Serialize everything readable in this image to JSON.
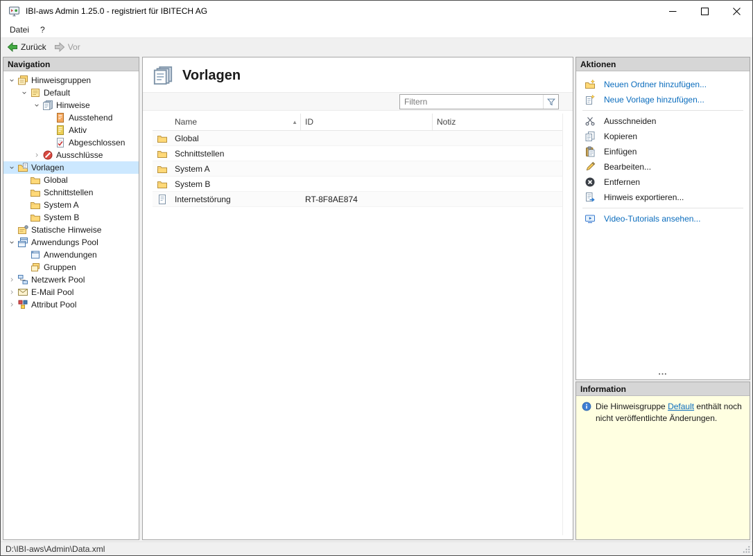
{
  "window": {
    "title": "IBI-aws Admin 1.25.0 - registriert für IBITECH AG"
  },
  "menu": {
    "items": [
      {
        "label": "Datei"
      },
      {
        "label": "?"
      }
    ]
  },
  "toolbar": {
    "back_label": "Zurück",
    "forward_label": "Vor",
    "forward_enabled": false
  },
  "navigation": {
    "header": "Navigation",
    "tree": [
      {
        "label": "Hinweisgruppen",
        "level": 0,
        "state": "expanded",
        "icon": "notice-groups-icon"
      },
      {
        "label": "Default",
        "level": 1,
        "state": "expanded",
        "icon": "notice-group-icon"
      },
      {
        "label": "Hinweise",
        "level": 2,
        "state": "expanded",
        "icon": "notices-icon"
      },
      {
        "label": "Ausstehend",
        "level": 3,
        "state": "leaf",
        "icon": "pending-notices-icon"
      },
      {
        "label": "Aktiv",
        "level": 3,
        "state": "leaf",
        "icon": "active-notices-icon"
      },
      {
        "label": "Abgeschlossen",
        "level": 3,
        "state": "leaf",
        "icon": "completed-notices-icon"
      },
      {
        "label": "Ausschlüsse",
        "level": 2,
        "state": "collapsed",
        "icon": "exclusions-icon"
      },
      {
        "label": "Vorlagen",
        "level": 0,
        "state": "expanded",
        "icon": "templates-folder-icon",
        "selected": true
      },
      {
        "label": "Global",
        "level": 1,
        "state": "leaf",
        "icon": "folder-icon"
      },
      {
        "label": "Schnittstellen",
        "level": 1,
        "state": "leaf",
        "icon": "folder-icon"
      },
      {
        "label": "System A",
        "level": 1,
        "state": "leaf",
        "icon": "folder-icon"
      },
      {
        "label": "System B",
        "level": 1,
        "state": "leaf",
        "icon": "folder-icon"
      },
      {
        "label": "Statische Hinweise",
        "level": 0,
        "state": "leaf",
        "icon": "static-notices-icon"
      },
      {
        "label": "Anwendungs Pool",
        "level": 0,
        "state": "expanded",
        "icon": "application-pool-icon"
      },
      {
        "label": "Anwendungen",
        "level": 1,
        "state": "leaf",
        "icon": "applications-icon"
      },
      {
        "label": "Gruppen",
        "level": 1,
        "state": "leaf",
        "icon": "groups-icon"
      },
      {
        "label": "Netzwerk Pool",
        "level": 0,
        "state": "collapsed",
        "icon": "network-pool-icon"
      },
      {
        "label": "E-Mail Pool",
        "level": 0,
        "state": "collapsed",
        "icon": "email-pool-icon"
      },
      {
        "label": "Attribut Pool",
        "level": 0,
        "state": "collapsed",
        "icon": "attribute-pool-icon"
      }
    ]
  },
  "main": {
    "title": "Vorlagen",
    "filter": {
      "placeholder": "Filtern"
    },
    "table": {
      "columns": [
        "Name",
        "ID",
        "Notiz"
      ],
      "sort": {
        "column": "Name",
        "direction": "asc"
      },
      "sort_indicator": "▲",
      "rows": [
        {
          "name": "Global",
          "id": "",
          "notiz": "",
          "type": "folder"
        },
        {
          "name": "Schnittstellen",
          "id": "",
          "notiz": "",
          "type": "folder"
        },
        {
          "name": "System A",
          "id": "",
          "notiz": "",
          "type": "folder"
        },
        {
          "name": "System B",
          "id": "",
          "notiz": "",
          "type": "folder"
        },
        {
          "name": "Internetstörung",
          "id": "RT-8F8AE874",
          "notiz": "",
          "type": "template"
        }
      ]
    }
  },
  "actions": {
    "header": "Aktionen",
    "items": [
      {
        "label": "Neuen Ordner hinzufügen...",
        "style": "link",
        "icon": "new-folder-icon"
      },
      {
        "label": "Neue Vorlage hinzufügen...",
        "style": "link",
        "icon": "new-template-icon"
      },
      {
        "label": "Ausschneiden",
        "style": "normal",
        "icon": "cut-icon"
      },
      {
        "label": "Kopieren",
        "style": "normal",
        "icon": "copy-icon"
      },
      {
        "label": "Einfügen",
        "style": "normal",
        "icon": "paste-icon"
      },
      {
        "label": "Bearbeiten...",
        "style": "normal",
        "icon": "edit-icon"
      },
      {
        "label": "Entfernen",
        "style": "normal",
        "icon": "remove-icon"
      },
      {
        "label": "Hinweis exportieren...",
        "style": "normal",
        "icon": "export-icon"
      },
      {
        "label": "Video-Tutorials ansehen...",
        "style": "link",
        "icon": "video-icon"
      }
    ],
    "splitter": "..."
  },
  "information": {
    "header": "Information",
    "text_before": "Die Hinweisgruppe ",
    "link": "Default",
    "text_after": " enthält noch nicht veröffentlichte Änderungen."
  },
  "statusbar": {
    "path": "D:\\IBI-aws\\Admin\\Data.xml"
  },
  "colors": {
    "selection": "#cce8ff",
    "link": "#0a6cbd",
    "info_background": "#ffffe1",
    "panel_header": "#d6d6d6"
  }
}
